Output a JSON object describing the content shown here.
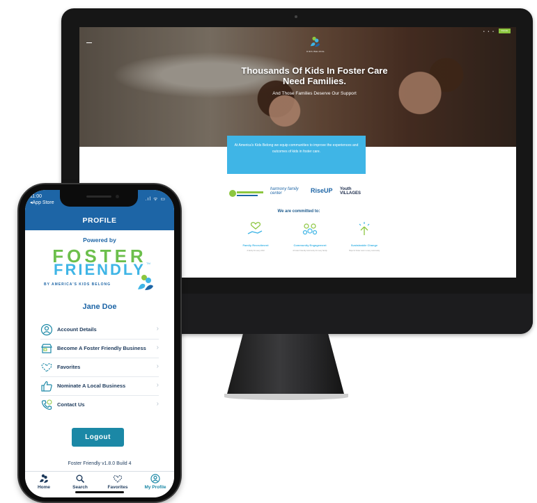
{
  "colors": {
    "brand_blue": "#1d65a6",
    "foster_green": "#6cbf4c",
    "friendly_cyan": "#3fb5e6",
    "logout_teal": "#1b88a6",
    "imac_black": "#161616"
  },
  "desktop": {
    "brand_logo_text": "KIDS BELONG",
    "hero_title": "Thousands Of Kids In Foster Care Need Families.",
    "hero_subtitle": "And Those Families Deserve Our Support",
    "header_button": "Donate",
    "mission": "At America's Kids Belong we equip communities to improve the experiences and outcomes of kids in foster care.",
    "partners": [
      "",
      "harmony family center",
      "RiseUP",
      "Youth VILLAGES"
    ],
    "committed_heading": "We are committed to:",
    "pillars": [
      {
        "label": "Family Recruitment",
        "desc": "A family for every child",
        "icon": "heart-hand-icon"
      },
      {
        "label": "Community Engagement",
        "desc": "A Foster Friendly community for every family",
        "icon": "people-group-icon"
      },
      {
        "label": "Sustainable Change",
        "desc": "Hope for foster care in every community",
        "icon": "growth-icon"
      }
    ]
  },
  "phone": {
    "status": {
      "time": "11:00",
      "back": "◂App Store",
      "icons": ".ıl ᯤ ▭"
    },
    "header_title": "PROFILE",
    "powered_by": "Powered by",
    "brand": {
      "foster": "FOSTER",
      "friendly": "FRIENDLY",
      "tm": "TM",
      "byline": "BY AMERICA'S KIDS BELONG"
    },
    "user_name": "Jane Doe",
    "menu": [
      {
        "label": "Account Details",
        "icon": "user-circle-icon"
      },
      {
        "label": "Become A Foster Friendly Business",
        "icon": "storefront-icon"
      },
      {
        "label": "Favorites",
        "icon": "heart-icon"
      },
      {
        "label": "Nominate A Local Business",
        "icon": "thumbs-up-icon"
      },
      {
        "label": "Contact Us",
        "icon": "phone-icon"
      }
    ],
    "chevron": "›",
    "logout_label": "Logout",
    "version": "Foster Friendly v1.8.0 Build 4",
    "tabs": [
      {
        "label": "Home",
        "icon": "home-logo-icon",
        "active": false
      },
      {
        "label": "Search",
        "icon": "search-icon",
        "active": false
      },
      {
        "label": "Favorites",
        "icon": "heart-icon",
        "active": false
      },
      {
        "label": "My Profile",
        "icon": "user-circle-icon",
        "active": true
      }
    ]
  }
}
